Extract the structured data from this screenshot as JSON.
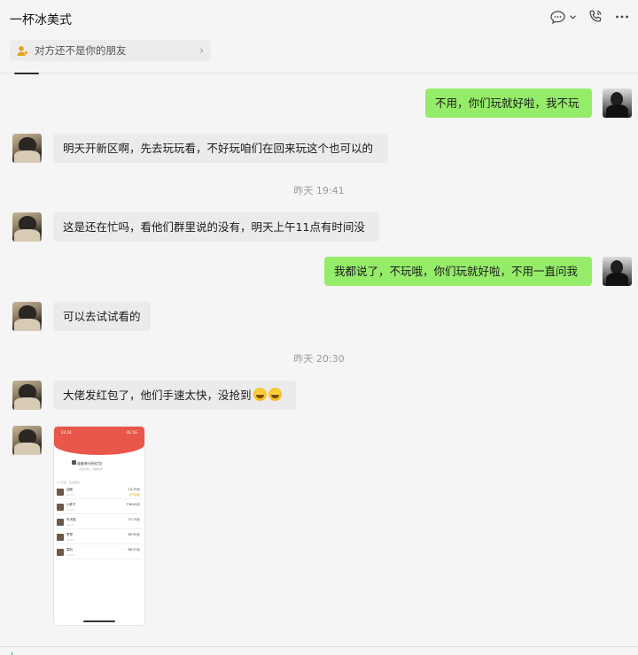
{
  "chat": {
    "title": "一杯冰美式",
    "notice": "对方还不是你的朋友"
  },
  "header_icons": {
    "chat_info": "chat-bubble-icon",
    "dropdown": "chevron-down-icon",
    "call": "phone-call-icon",
    "more": "more-icon"
  },
  "messages": [
    {
      "sender": "self",
      "text": "不用，你们玩就好啦，我不玩"
    },
    {
      "sender": "peer",
      "text": "明天开新区啊，先去玩玩看，不好玩咱们在回来玩这个也可以的"
    },
    {
      "type": "time",
      "text": "昨天 19:41"
    },
    {
      "sender": "peer",
      "text": "这是还在忙吗，看他们群里说的没有，明天上午11点有时间没"
    },
    {
      "sender": "self",
      "text": "我都说了，不玩哦，你们玩就好啦，不用一直问我"
    },
    {
      "sender": "peer",
      "text": "可以去试试看的"
    },
    {
      "type": "time",
      "text": "昨天 20:30"
    },
    {
      "sender": "peer",
      "text": "大佬发红包了，他们手速太快，没抢到",
      "emoji_count": 2
    },
    {
      "sender": "peer",
      "type": "image"
    }
  ],
  "red_packet_shot": {
    "status_time": "22:24",
    "status_right": "4G 5G",
    "sender": "谁能来分析红包",
    "sub": "大吉大利，今晚吃鸡",
    "summary": "5个红包，共领取完",
    "rows": [
      {
        "name": "迎面",
        "time": "21:21",
        "amount": "14.75元",
        "best": "手气最佳"
      },
      {
        "name": "小胖子",
        "time": "21:21",
        "amount": "738.00元",
        "best": ""
      },
      {
        "name": "冬天猫",
        "time": "21:21",
        "amount": "72.74元",
        "best": ""
      },
      {
        "name": "思琴",
        "time": "21:21",
        "amount": "89.35元",
        "best": ""
      },
      {
        "name": "霖利",
        "time": "21:21",
        "amount": "86.37元",
        "best": ""
      }
    ]
  }
}
